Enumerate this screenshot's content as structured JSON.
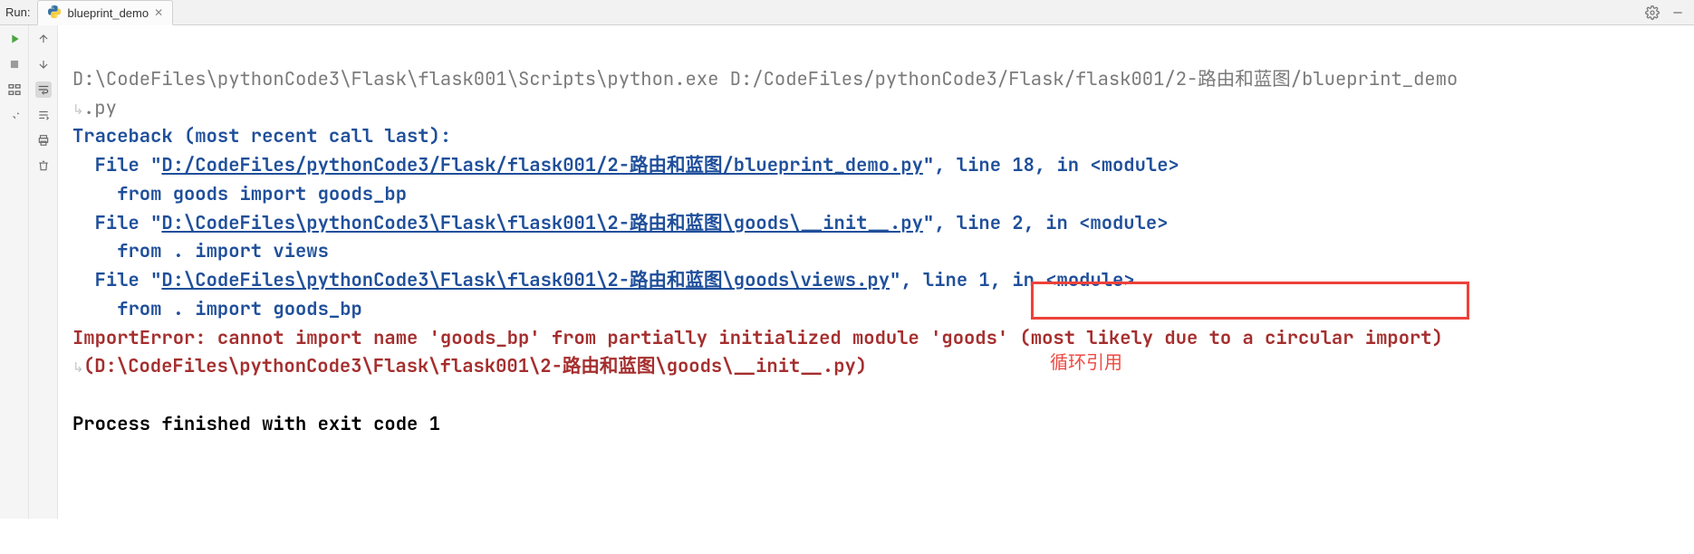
{
  "header": {
    "run_label": "Run:",
    "tab_name": "blueprint_demo"
  },
  "console": {
    "cmd": "D:\\CodeFiles\\pythonCode3\\Flask\\flask001\\Scripts\\python.exe D:/CodeFiles/pythonCode3/Flask/flask001/2-路由和蓝图/blueprint_demo",
    "cmd_wrap": ".py",
    "traceback": "Traceback (most recent call last):",
    "file1_pre": "  File \"",
    "file1_link": "D:/CodeFiles/pythonCode3/Flask/flask001/2-路由和蓝图/blueprint_demo.py",
    "file1_post": "\", line 18, in <module>",
    "line1": "    from goods import goods_bp",
    "file2_pre": "  File \"",
    "file2_link": "D:\\CodeFiles\\pythonCode3\\Flask\\flask001\\2-路由和蓝图\\goods\\__init__.py",
    "file2_post": "\", line 2, in <module>",
    "line2": "    from . import views",
    "file3_pre": "  File \"",
    "file3_link": "D:\\CodeFiles\\pythonCode3\\Flask\\flask001\\2-路由和蓝图\\goods\\views.py",
    "file3_post": "\", line 1, in <module>",
    "line3": "    from . import goods_bp",
    "error_a": "ImportError: cannot import name 'goods_bp' from partially initialized module 'goods'",
    "error_b": " (most likely due to a circular import) ",
    "error_wrap": "(D:\\CodeFiles\\pythonCode3\\Flask\\flask001\\2-路由和蓝图\\goods\\__init__.py)",
    "blank": "",
    "process": "Process finished with exit code 1"
  },
  "annotation": "循环引用"
}
